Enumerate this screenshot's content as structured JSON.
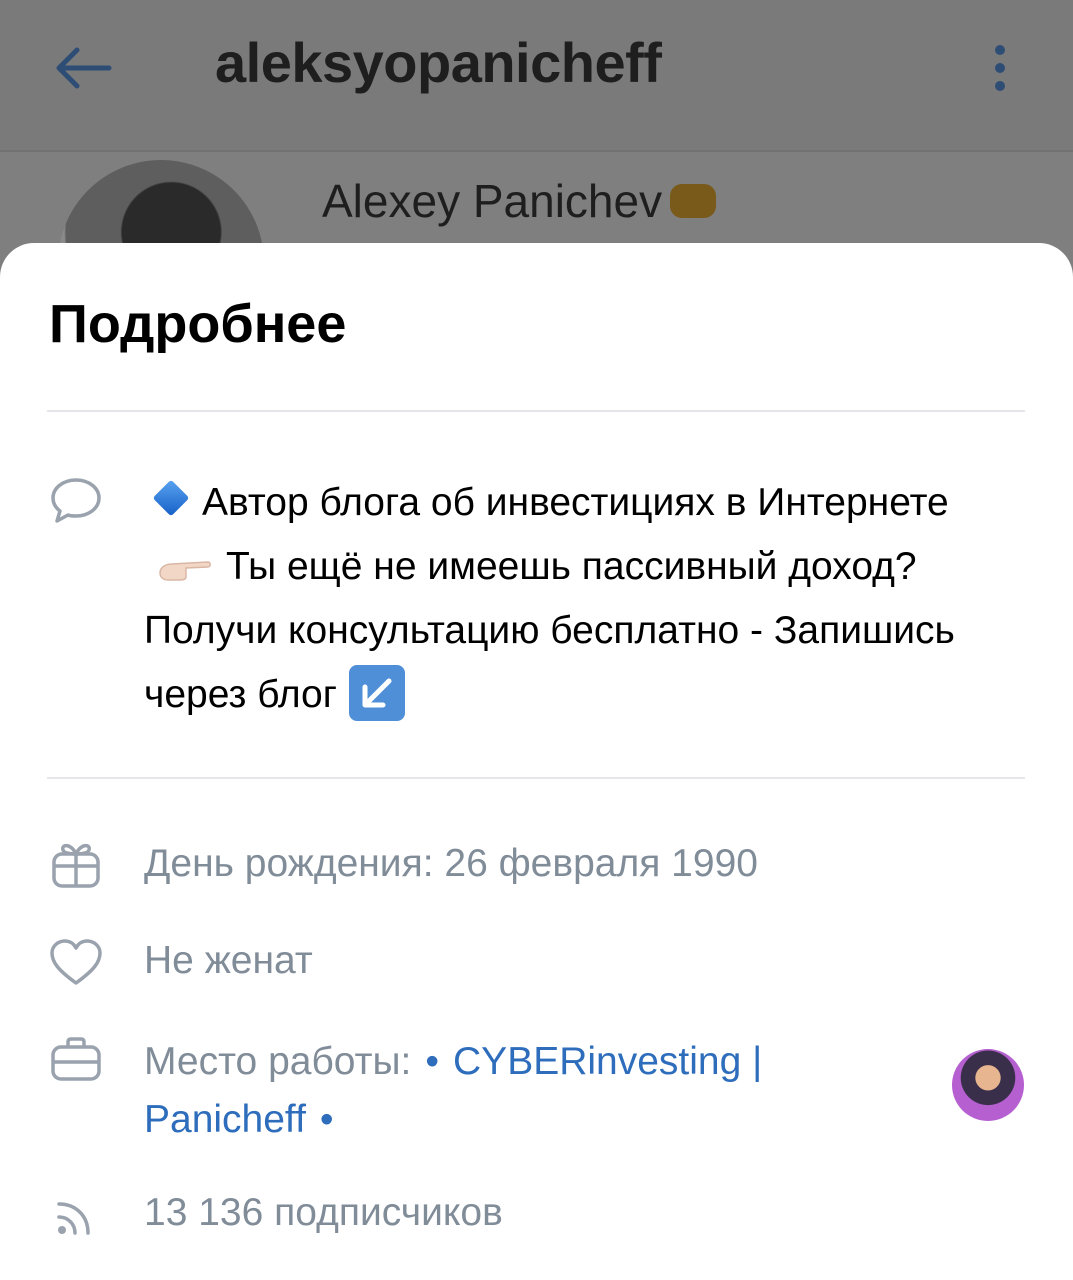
{
  "background": {
    "username": "aleksyopanicheff",
    "display_name": "Alexey Panichev"
  },
  "sheet": {
    "title": "Подробнее",
    "about": {
      "part1": "Автор блога об инвестициях в Интернете",
      "part2": "Ты ещё не имеешь пассивный доход? Получи консультацию бесплатно - Запишись через блог"
    },
    "birthday": "День рождения: 26 февраля 1990",
    "relationship": "Не женат",
    "work": {
      "label": "Место работы:",
      "company_line1": "CYBERinvesting |",
      "company_line2": "Panicheff"
    },
    "followers": "13 136 подписчиков"
  },
  "colors": {
    "link": "#2d6dbb",
    "secondary_text": "#818c99",
    "icon": "#99a2ad",
    "accent_dark": "#2e4d75"
  },
  "icons": {
    "back": "arrow-left-icon",
    "more": "more-vertical-icon",
    "about": "speech-bubble-icon",
    "birthday": "gift-icon",
    "relationship": "heart-icon",
    "work": "briefcase-icon",
    "followers": "rss-icon"
  }
}
